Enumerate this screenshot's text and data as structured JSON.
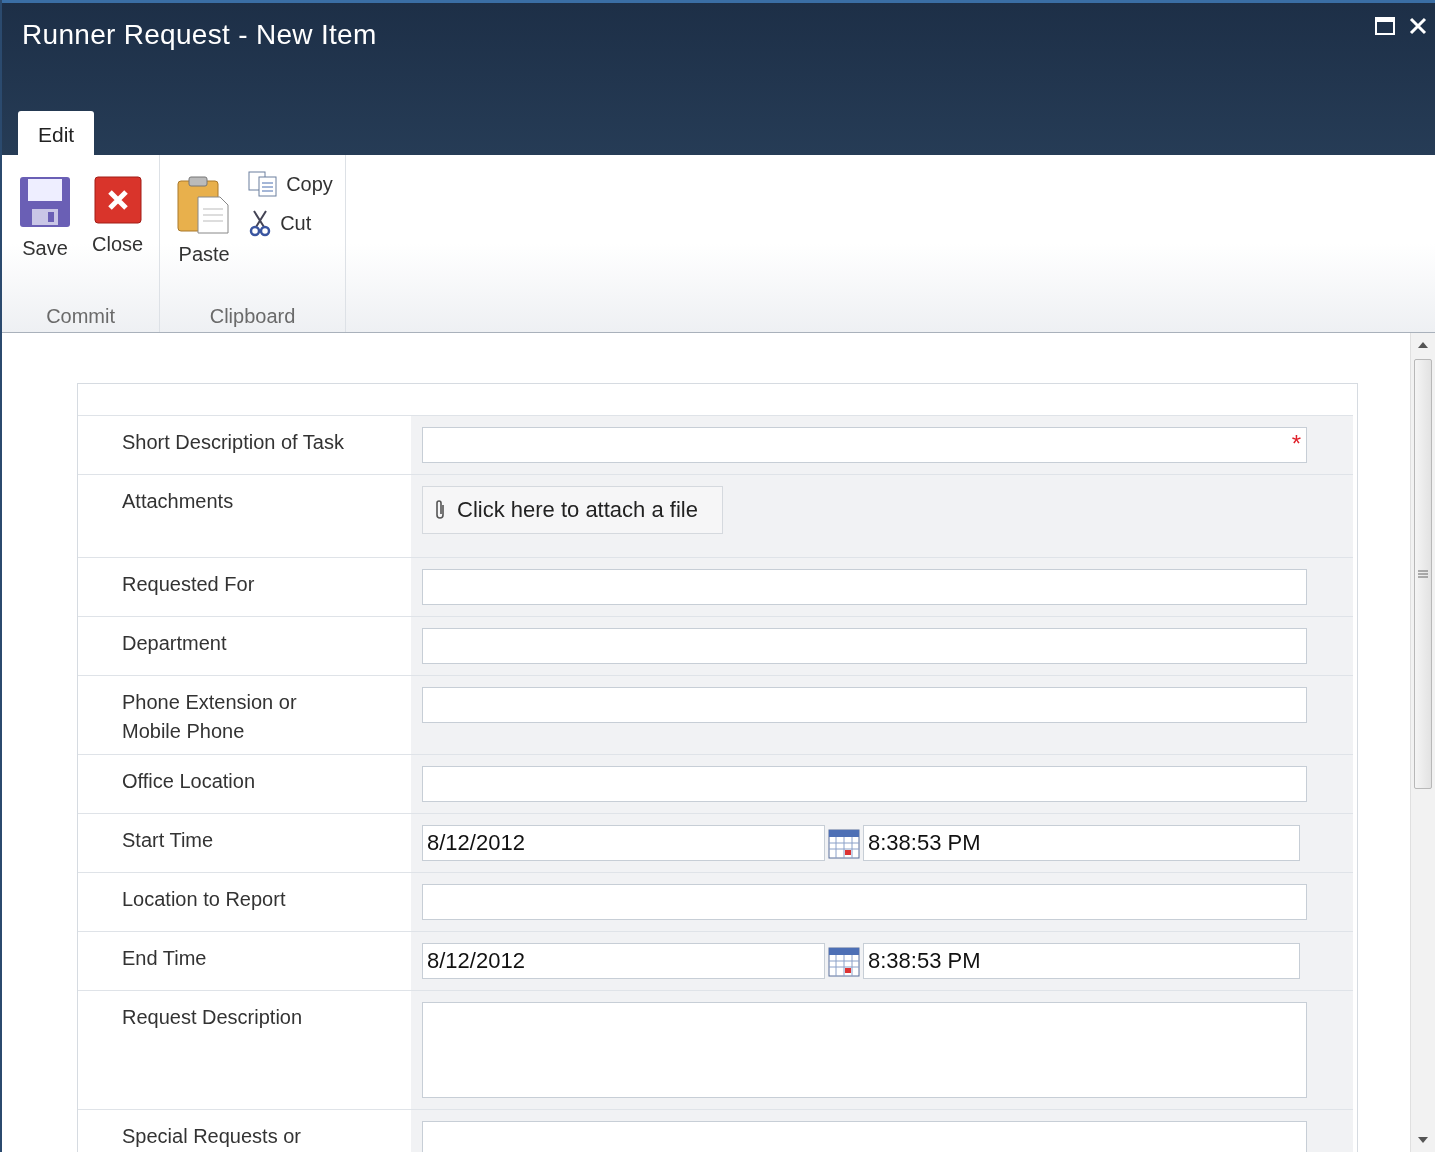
{
  "window": {
    "title": "Runner Request - New Item"
  },
  "tabs": [
    {
      "label": "Edit",
      "selected": true
    }
  ],
  "ribbon": {
    "groups": [
      {
        "label": "Commit",
        "large_buttons": [
          {
            "label": "Save"
          },
          {
            "label": "Close"
          }
        ]
      },
      {
        "label": "Clipboard",
        "large_buttons": [
          {
            "label": "Paste"
          }
        ],
        "small_buttons": [
          {
            "label": "Copy"
          },
          {
            "label": "Cut"
          }
        ]
      }
    ]
  },
  "form": {
    "fields": [
      {
        "label": "Short Description of Task",
        "kind": "text",
        "required_mark": "*"
      },
      {
        "label": "Attachments",
        "kind": "attachment",
        "button_label": "Click here to attach a file"
      },
      {
        "label": "Requested For",
        "kind": "text"
      },
      {
        "label": "Department",
        "kind": "text"
      },
      {
        "label": "Phone Extension or\nMobile Phone",
        "kind": "text"
      },
      {
        "label": "Office Location",
        "kind": "text"
      },
      {
        "label": "Start Time",
        "kind": "datetime",
        "date": "8/12/2012",
        "time": "8:38:53 PM"
      },
      {
        "label": "Location to Report",
        "kind": "text"
      },
      {
        "label": "End Time",
        "kind": "datetime",
        "date": "8/12/2012",
        "time": "8:38:53 PM"
      },
      {
        "label": "Request Description",
        "kind": "textarea"
      },
      {
        "label": "Special Requests or",
        "kind": "textarea"
      }
    ]
  }
}
